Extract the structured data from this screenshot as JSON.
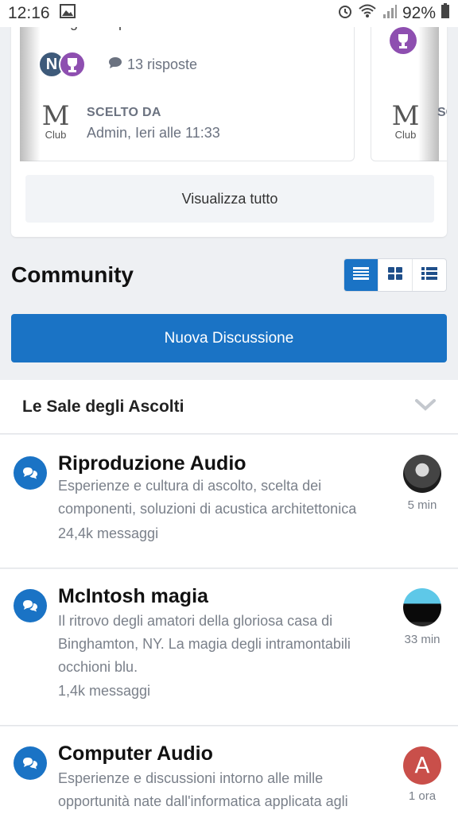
{
  "status_bar": {
    "time": "12:16",
    "battery": "92%"
  },
  "top_card": {
    "snippet": "consigliati in passato dai membri della...",
    "replies": "13 risposte",
    "avatar_letter": "N",
    "logo_big": "M",
    "logo_small": "Club",
    "chosen_label": "SCELTO DA",
    "chosen_by": "Admin, Ieri alle 11:33",
    "view_all": "Visualizza tutto"
  },
  "community": {
    "title": "Community",
    "new_discussion": "Nuova Discussione"
  },
  "section": {
    "title": "Le Sale degli Ascolti",
    "forums": [
      {
        "title": "Riproduzione Audio",
        "description": "Esperienze e cultura di ascolto, scelta dei componenti, soluzioni di acustica architettonica",
        "count": "24,4k messaggi",
        "time": "5 min"
      },
      {
        "title": "McIntosh magia",
        "description": "Il ritrovo degli amatori della gloriosa casa di Binghamton, NY. La magia degli intramontabili occhioni blu.",
        "count": "1,4k messaggi",
        "time": "33 min"
      },
      {
        "title": "Computer Audio",
        "description": "Esperienze e discussioni intorno alle mille opportunità nate dall'informatica applicata agli",
        "count": "",
        "time": "1 ora",
        "avatar_letter": "A"
      }
    ]
  },
  "colors": {
    "accent": "#1a73c5",
    "trophy": "#8e4fb0"
  }
}
